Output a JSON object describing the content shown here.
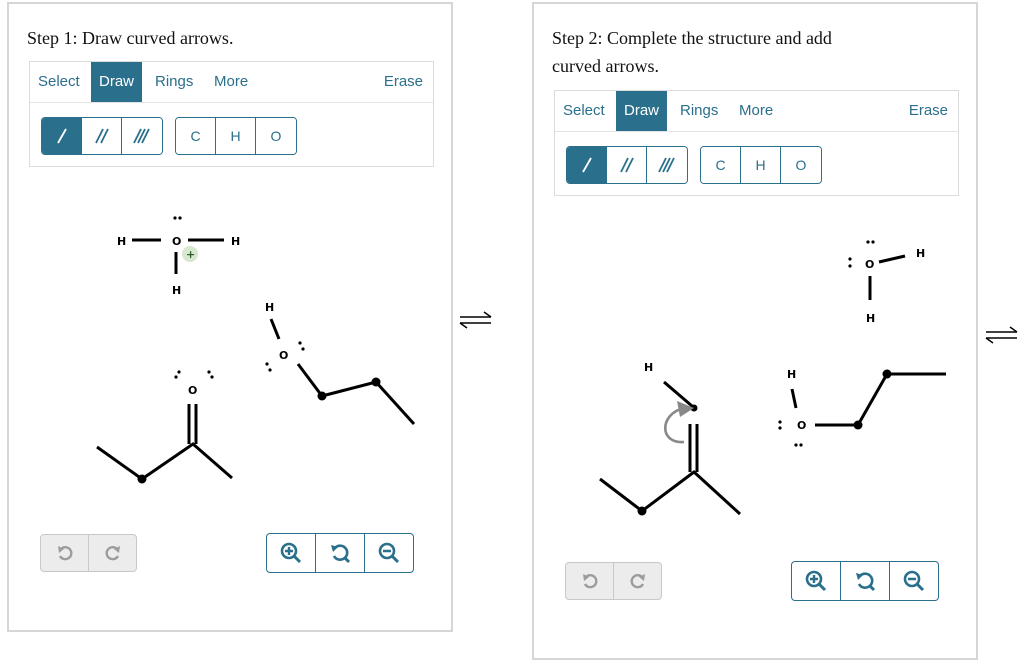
{
  "step1": {
    "title": "Step 1: Draw curved arrows.",
    "tabs": {
      "select": "Select",
      "draw": "Draw",
      "rings": "Rings",
      "more": "More",
      "erase": "Erase"
    },
    "atoms": {
      "c": "C",
      "h": "H",
      "o": "O"
    }
  },
  "step2": {
    "title_line1": "Step 2: Complete the structure and add",
    "title_line2": "curved arrows.",
    "tabs": {
      "select": "Select",
      "draw": "Draw",
      "rings": "Rings",
      "more": "More",
      "erase": "Erase"
    },
    "atoms": {
      "c": "C",
      "h": "H",
      "o": "O"
    }
  },
  "molecule_labels": {
    "h": "H",
    "o": "O",
    "charge_plus": "+"
  },
  "colors": {
    "accent": "#2a6f8b",
    "border": "#d6d6d6",
    "disabled": "#ececec"
  },
  "icons": [
    "single-bond-icon",
    "double-bond-icon",
    "triple-bond-icon",
    "undo-icon",
    "redo-icon",
    "zoom-in-icon",
    "zoom-reset-icon",
    "zoom-out-icon",
    "equilibrium-arrow-icon",
    "curved-arrow-icon"
  ]
}
